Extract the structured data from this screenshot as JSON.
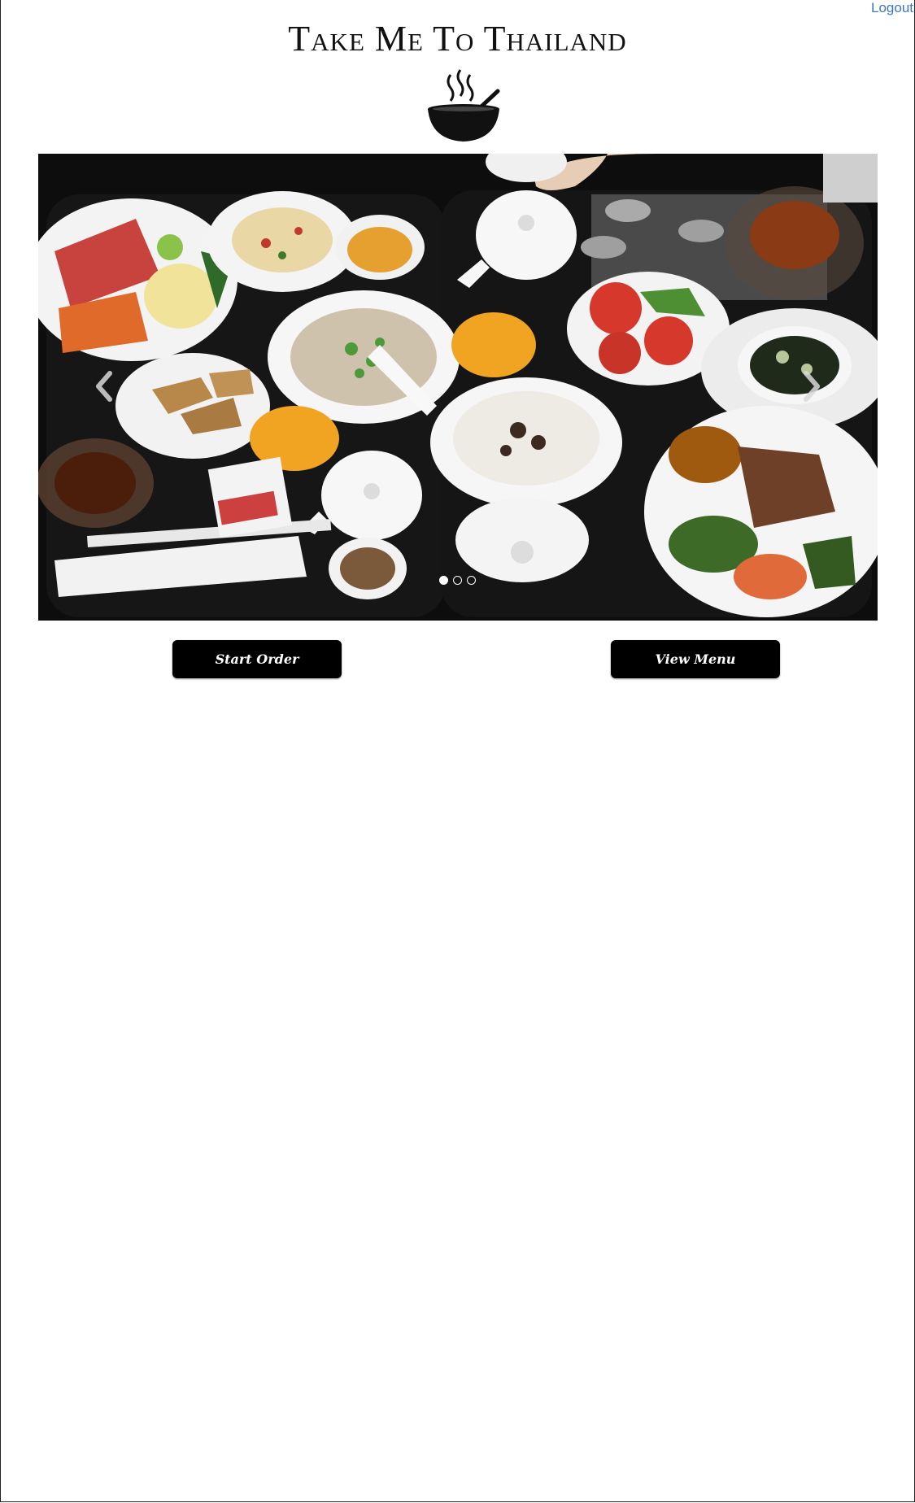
{
  "header": {
    "logout_label": "Logout",
    "brand_title": "Take Me To Thailand",
    "logo_icon": "steaming-bowl-icon"
  },
  "carousel": {
    "prev_icon": "chevron-left-icon",
    "next_icon": "chevron-right-icon",
    "slide_count": 3,
    "active_slide": 1
  },
  "actions": {
    "start_order_label": "Start Order",
    "view_menu_label": "View Menu"
  },
  "colors": {
    "link": "#3a78c4",
    "button_bg": "#000000",
    "button_text": "#ffffff",
    "tray": "#0c0c0c"
  }
}
